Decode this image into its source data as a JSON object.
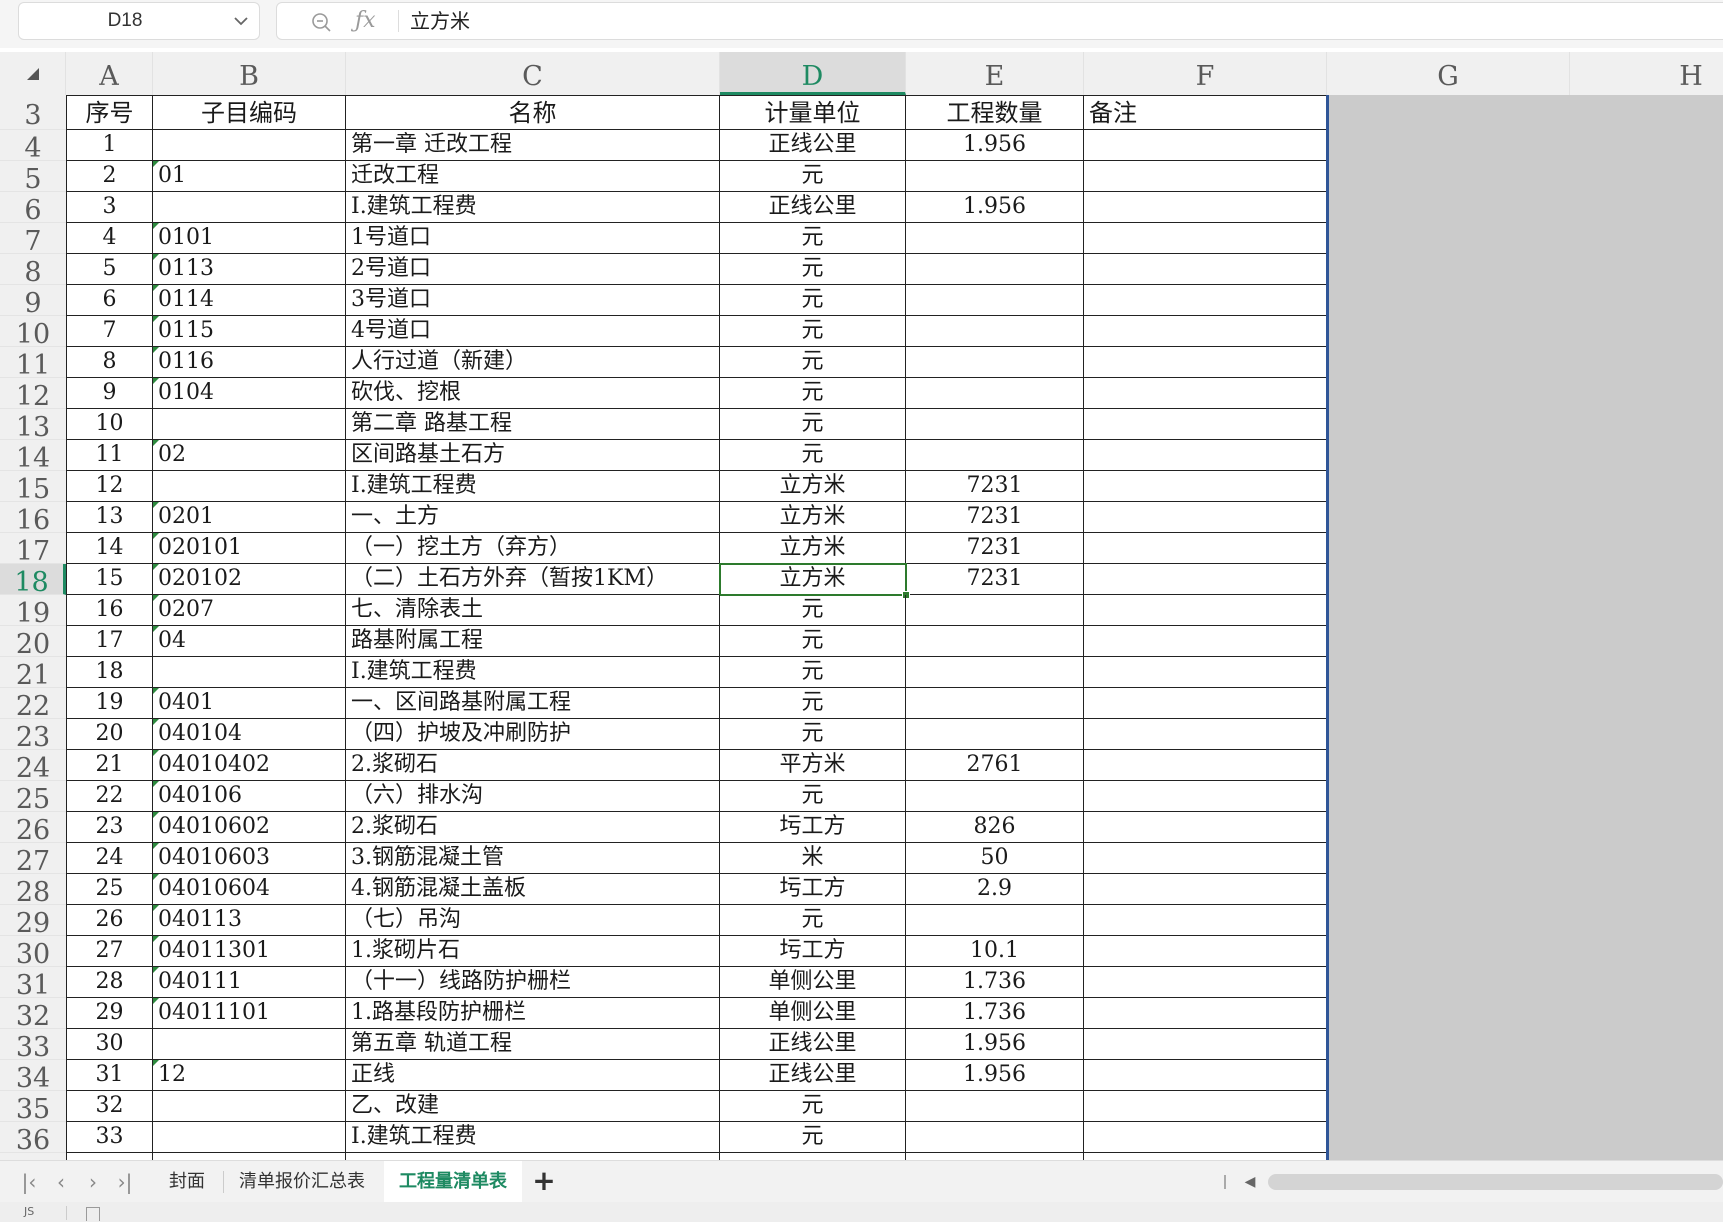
{
  "formula_bar": {
    "cell_reference": "D18",
    "formula_value": "立方米"
  },
  "columns": [
    "A",
    "B",
    "C",
    "D",
    "E",
    "F",
    "G",
    "H"
  ],
  "active_column": "D",
  "active_row": 18,
  "header_row": {
    "row_number": 3,
    "cells": [
      "序号",
      "子目编码",
      "名称",
      "计量单位",
      "工程数量",
      "备注"
    ]
  },
  "rows": [
    {
      "row": 4,
      "seq": "1",
      "code": "",
      "name": "第一章 迁改工程",
      "unit": "正线公里",
      "qty": "1.956",
      "note": ""
    },
    {
      "row": 5,
      "seq": "2",
      "code": "01",
      "name": "迁改工程",
      "unit": "元",
      "qty": "",
      "note": ""
    },
    {
      "row": 6,
      "seq": "3",
      "code": "",
      "name": "Ⅰ.建筑工程费",
      "unit": "正线公里",
      "qty": "1.956",
      "note": ""
    },
    {
      "row": 7,
      "seq": "4",
      "code": "0101",
      "name": "1号道口",
      "unit": "元",
      "qty": "",
      "note": ""
    },
    {
      "row": 8,
      "seq": "5",
      "code": "0113",
      "name": "2号道口",
      "unit": "元",
      "qty": "",
      "note": ""
    },
    {
      "row": 9,
      "seq": "6",
      "code": "0114",
      "name": "3号道口",
      "unit": "元",
      "qty": "",
      "note": ""
    },
    {
      "row": 10,
      "seq": "7",
      "code": "0115",
      "name": "4号道口",
      "unit": "元",
      "qty": "",
      "note": ""
    },
    {
      "row": 11,
      "seq": "8",
      "code": "0116",
      "name": "人行过道（新建）",
      "unit": "元",
      "qty": "",
      "note": ""
    },
    {
      "row": 12,
      "seq": "9",
      "code": "0104",
      "name": "砍伐、挖根",
      "unit": "元",
      "qty": "",
      "note": ""
    },
    {
      "row": 13,
      "seq": "10",
      "code": "",
      "name": "第二章 路基工程",
      "unit": "元",
      "qty": "",
      "note": ""
    },
    {
      "row": 14,
      "seq": "11",
      "code": "02",
      "name": "区间路基土石方",
      "unit": "元",
      "qty": "",
      "note": ""
    },
    {
      "row": 15,
      "seq": "12",
      "code": "",
      "name": "Ⅰ.建筑工程费",
      "unit": "立方米",
      "qty": "7231",
      "note": ""
    },
    {
      "row": 16,
      "seq": "13",
      "code": "0201",
      "name": "一、土方",
      "unit": "立方米",
      "qty": "7231",
      "note": ""
    },
    {
      "row": 17,
      "seq": "14",
      "code": "020101",
      "name": "（一）挖土方（弃方）",
      "unit": "立方米",
      "qty": "7231",
      "note": ""
    },
    {
      "row": 18,
      "seq": "15",
      "code": "020102",
      "name": "（二）土石方外弃（暂按1KM）",
      "unit": "立方米",
      "qty": "7231",
      "note": ""
    },
    {
      "row": 19,
      "seq": "16",
      "code": "0207",
      "name": "七、清除表土",
      "unit": "元",
      "qty": "",
      "note": ""
    },
    {
      "row": 20,
      "seq": "17",
      "code": "04",
      "name": "路基附属工程",
      "unit": "元",
      "qty": "",
      "note": ""
    },
    {
      "row": 21,
      "seq": "18",
      "code": "",
      "name": "Ⅰ.建筑工程费",
      "unit": "元",
      "qty": "",
      "note": ""
    },
    {
      "row": 22,
      "seq": "19",
      "code": "0401",
      "name": "一、区间路基附属工程",
      "unit": "元",
      "qty": "",
      "note": ""
    },
    {
      "row": 23,
      "seq": "20",
      "code": "040104",
      "name": "（四）护坡及冲刷防护",
      "unit": "元",
      "qty": "",
      "note": ""
    },
    {
      "row": 24,
      "seq": "21",
      "code": "04010402",
      "name": "2.浆砌石",
      "unit": "平方米",
      "qty": "2761",
      "note": ""
    },
    {
      "row": 25,
      "seq": "22",
      "code": "040106",
      "name": "（六）排水沟",
      "unit": "元",
      "qty": "",
      "note": ""
    },
    {
      "row": 26,
      "seq": "23",
      "code": "04010602",
      "name": "2.浆砌石",
      "unit": "圬工方",
      "qty": "826",
      "note": ""
    },
    {
      "row": 27,
      "seq": "24",
      "code": "04010603",
      "name": "3.钢筋混凝土管",
      "unit": "米",
      "qty": "50",
      "note": ""
    },
    {
      "row": 28,
      "seq": "25",
      "code": "04010604",
      "name": "4.钢筋混凝土盖板",
      "unit": "圬工方",
      "qty": "2.9",
      "note": ""
    },
    {
      "row": 29,
      "seq": "26",
      "code": "040113",
      "name": "（七）吊沟",
      "unit": "元",
      "qty": "",
      "note": ""
    },
    {
      "row": 30,
      "seq": "27",
      "code": "04011301",
      "name": "1.浆砌片石",
      "unit": "圬工方",
      "qty": "10.1",
      "note": ""
    },
    {
      "row": 31,
      "seq": "28",
      "code": "040111",
      "name": "（十一）线路防护栅栏",
      "unit": "单侧公里",
      "qty": "1.736",
      "note": ""
    },
    {
      "row": 32,
      "seq": "29",
      "code": "04011101",
      "name": "1.路基段防护栅栏",
      "unit": "单侧公里",
      "qty": "1.736",
      "note": ""
    },
    {
      "row": 33,
      "seq": "30",
      "code": "",
      "name": "第五章 轨道工程",
      "unit": "正线公里",
      "qty": "1.956",
      "note": ""
    },
    {
      "row": 34,
      "seq": "31",
      "code": "12",
      "name": "正线",
      "unit": "正线公里",
      "qty": "1.956",
      "note": ""
    },
    {
      "row": 35,
      "seq": "32",
      "code": "",
      "name": "乙、改建",
      "unit": "元",
      "qty": "",
      "note": ""
    },
    {
      "row": 36,
      "seq": "33",
      "code": "",
      "name": "Ⅰ.建筑工程费",
      "unit": "元",
      "qty": "",
      "note": ""
    }
  ],
  "sheet_tabs": [
    {
      "label": "封面",
      "active": false
    },
    {
      "label": "清单报价汇总表",
      "active": false
    },
    {
      "label": "工程量清单表",
      "active": true
    }
  ],
  "nav_icons": [
    "first-sheet-icon",
    "prev-sheet-icon",
    "next-sheet-icon",
    "last-sheet-icon"
  ],
  "status_bar": {
    "indicator": "JS"
  },
  "colors": {
    "accent": "#1e8a62",
    "selection": "#2d7a2d",
    "print_area_edge": "#2f5597",
    "grey_area": "#cbcbcb"
  }
}
